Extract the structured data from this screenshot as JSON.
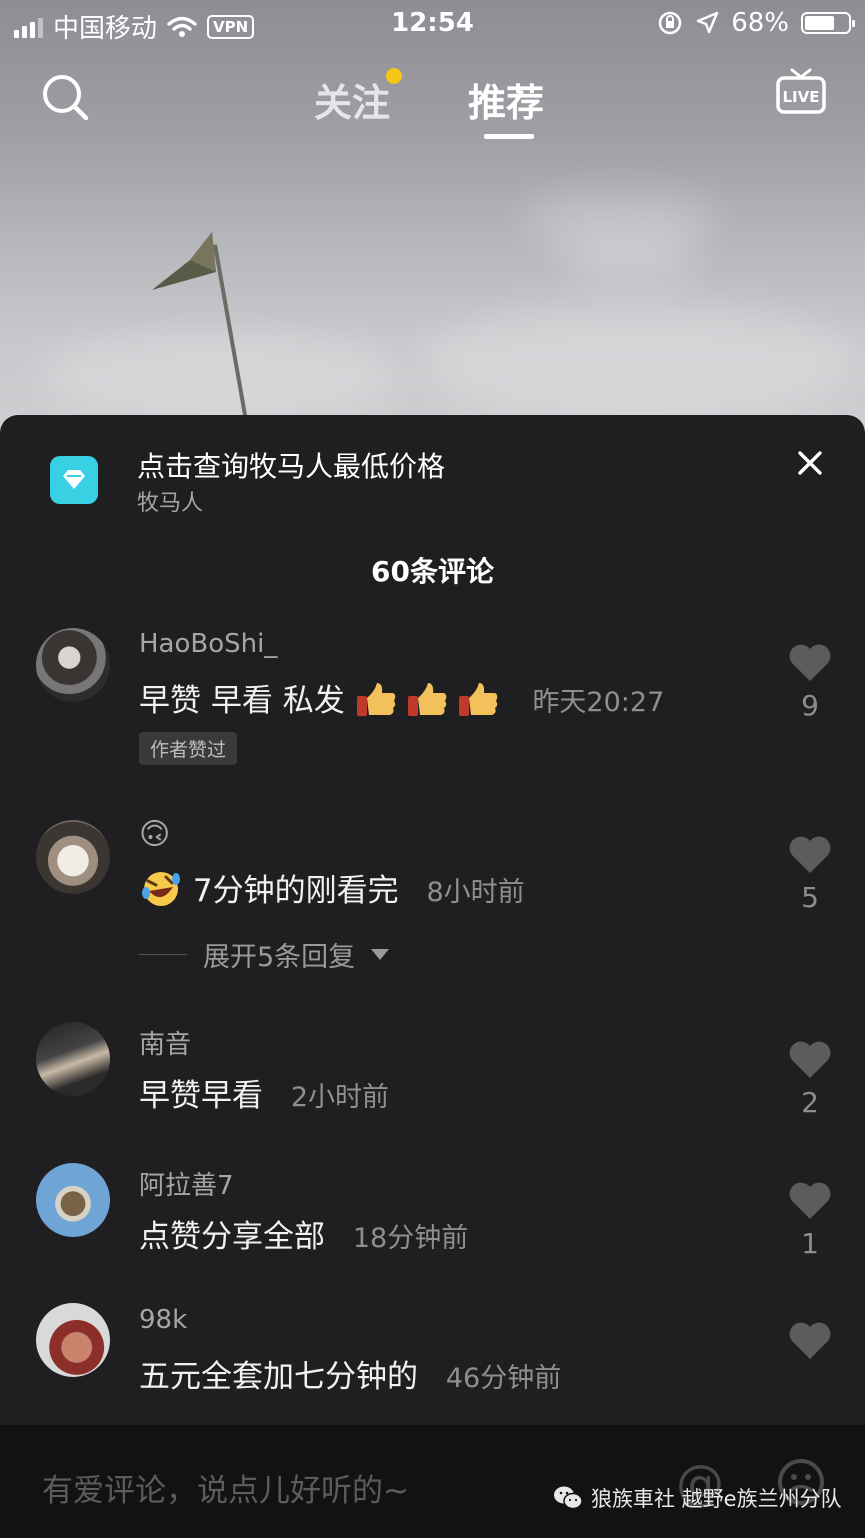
{
  "status_bar": {
    "carrier": "中国移动",
    "vpn": "VPN",
    "time": "12:54",
    "battery": "68%",
    "battery_level": 0.68
  },
  "top_nav": {
    "search_icon": "search-icon",
    "tabs": [
      {
        "label": "关注",
        "active": false,
        "has_dot": true
      },
      {
        "label": "推荐",
        "active": true
      }
    ],
    "live_icon_text": "LIVE"
  },
  "ad": {
    "title": "点击查询牧马人最低价格",
    "subtitle": "牧马人",
    "icon": "diamond-icon",
    "accent": "#3ad0e4"
  },
  "comment_count": "60条评论",
  "comments": [
    {
      "user": "HaoBoShi_",
      "text": "早赞 早看 私发",
      "emoji": "thumbs-up x3",
      "time": "昨天20:27",
      "likes": "9",
      "badge": "作者赞过"
    },
    {
      "user": "🙃",
      "text": "7分钟的刚看完",
      "emoji": "rolling-laughing",
      "time": "8小时前",
      "likes": "5",
      "expand": "展开5条回复"
    },
    {
      "user": "南音",
      "text": "早赞早看",
      "time": "2小时前",
      "likes": "2"
    },
    {
      "user": "阿拉善7",
      "text": "点赞分享全部",
      "time": "18分钟前",
      "likes": "1"
    },
    {
      "user": "98k",
      "text": "五元全套加七分钟的",
      "time": "46分钟前",
      "likes": ""
    }
  ],
  "input": {
    "placeholder": "有爱评论，说点儿好听的~",
    "at_symbol": "@"
  },
  "watermark": "狼族車社 越野e族兰州分队"
}
